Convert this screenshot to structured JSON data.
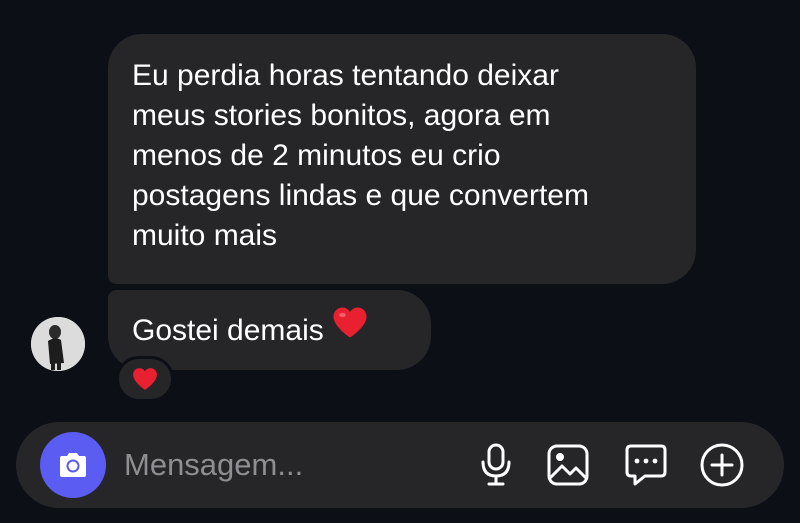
{
  "messages": [
    {
      "lines": [
        "Eu perdia horas tentando deixar",
        "meus stories bonitos, agora em",
        "menos de 2 minutos eu crio",
        "postagens lindas e que convertem",
        "muito mais"
      ]
    },
    {
      "text": "Gostei demais",
      "emoji": "heart",
      "reaction": "heart"
    }
  ],
  "composer": {
    "placeholder": "Mensagem...",
    "camera_icon": "camera-icon",
    "actions": [
      "microphone-icon",
      "gallery-icon",
      "sticker-icon",
      "plus-icon"
    ]
  },
  "colors": {
    "background": "#0c0f16",
    "bubble": "#262629",
    "accent": "#5b5cf2",
    "placeholder": "#8e8e93",
    "heart": "#e8202f"
  }
}
